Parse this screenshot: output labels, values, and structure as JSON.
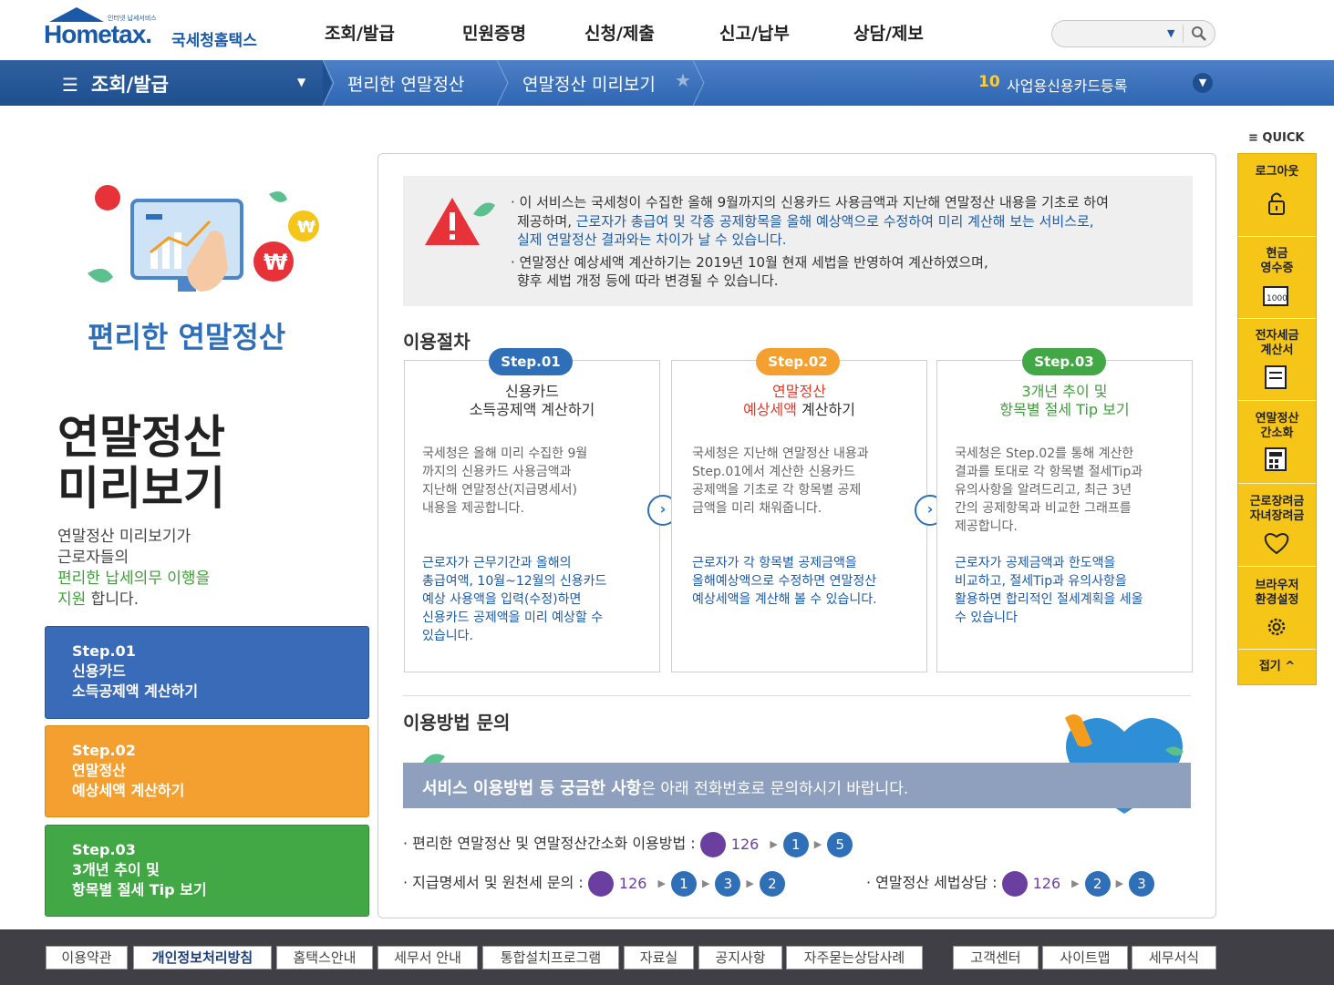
{
  "header": {
    "logo_tiny": "인터넷 납세서비스",
    "logo_brand": "Hometax.",
    "logo_brand_ko": "국세청홈택스",
    "nav": [
      "조회/발급",
      "민원증명",
      "신청/제출",
      "신고/납부",
      "상담/제보"
    ],
    "search": {
      "placeholder": ""
    }
  },
  "bluebar": {
    "menu_title": "조회/발급",
    "crumbs": [
      "편리한 연말정산",
      "연말정산 미리보기"
    ],
    "rank_number": "10",
    "rank_text": "사업용신용카드등록"
  },
  "left": {
    "brand": "편리한 연말정산",
    "title_line1": "연말정산",
    "title_line2": "미리보기",
    "desc_line1": "연말정산 미리보기가",
    "desc_line2": "근로자들의",
    "desc_line3_green": "편리한 납세의무 이행을",
    "desc_line4_green": "지원",
    "desc_line4_rest": " 합니다.",
    "steps": [
      {
        "line1": "Step.01",
        "line2": "신용카드",
        "line3": "소득공제액 계산하기"
      },
      {
        "line1": "Step.02",
        "line2": "연말정산",
        "line3": "예상세액 계산하기"
      },
      {
        "line1": "Step.03",
        "line2": "3개년 추이 및",
        "line3": "항목별 절세 Tip 보기"
      }
    ]
  },
  "notice": {
    "l1": "· 이 서비스는 국세청이 수집한 올해 9월까지의 신용카드 사용금액과 지난해 연말정산 내용을 기초로 하여",
    "l2a": "제공하며, ",
    "l2b": "근로자가 총급여 및 각종 공제항목을 올해 예상액으로 수정하여 미리 계산해 보는 서비스로,",
    "l3": "실제 연말정산 결과와는 차이가 날 수 있습니다.",
    "l4": "· 연말정산 예상세액 계산하기는 2019년 10월 현재 세법을 반영하여 계산하였으며,",
    "l5": "향후 세법 개정 등에 따라 변경될 수 있습니다."
  },
  "procedure": {
    "title": "이용절차",
    "cards": [
      {
        "pill": "Step.01",
        "title1": "신용카드",
        "title2": "소득공제액 계산하기",
        "body": [
          "국세청은 올해 미리 수집한 9월",
          "까지의 신용카드 사용금액과",
          "지난해 연말정산(지급명세서)",
          "내용을 제공합니다."
        ],
        "blue": [
          "근로자가 근무기간과 올해의",
          "총급여액, 10월~12월의 신용카드",
          "예상 사용액을 입력(수정)하면",
          "신용카드 공제액을 미리 예상할 수",
          "있습니다."
        ]
      },
      {
        "pill": "Step.02",
        "title1": "연말정산",
        "title2a": "예상세액",
        "title2b": " 계산하기",
        "body": [
          "국세청은 지난해 연말정산 내용과",
          "Step.01에서 계산한 신용카드",
          "공제액을 기초로 각 항목별 공제",
          "금액을 미리 채워줍니다."
        ],
        "blue": [
          "근로자가 각 항목별 공제금액을",
          "올해예상액으로 수정하면 연말정산",
          "예상세액을 계산해 볼 수 있습니다."
        ]
      },
      {
        "pill": "Step.03",
        "title1": "3개년 추이 및",
        "title2": "항목별 절세 Tip 보기",
        "body": [
          "국세청은 Step.02를 통해 계산한",
          "결과를 토대로 각 항목별 절세Tip과",
          "유의사항을 알려드리고, 최근 3년",
          "간의 공제항목과 비교한 그래프를",
          "제공합니다."
        ],
        "blue": [
          "근로자가 공제금액과 한도액을",
          "비교하고, 절세Tip과 유의사항을",
          "활용하면 합리적인 절세계획을 세울",
          "수 있습니다"
        ]
      }
    ]
  },
  "contact": {
    "title": "이용방법 문의",
    "banner_big": "서비스 이용방법 등 궁금한 사항",
    "banner_rest": "은 아래 전화번호로 문의하시기 바랍니다.",
    "line1_label": "· 편리한 연말정산 및 연말정산간소화 이용방법 :",
    "line1_num": "126",
    "line1_digits": [
      "1",
      "5"
    ],
    "line2_label": "· 지급명세서 및 원천세 문의 :",
    "line2_num": "126",
    "line2_digits": [
      "1",
      "3",
      "2"
    ],
    "line3_label": "· 연말정산 세법상담 :",
    "line3_num": "126",
    "line3_digits": [
      "2",
      "3"
    ]
  },
  "quick": {
    "title": "QUICK",
    "items": [
      "로그아웃",
      "현금",
      "영수증",
      "전자세금",
      "계산서",
      "연말정산",
      "간소화",
      "근로장려금",
      "자녀장려금",
      "브라우저",
      "환경설정"
    ],
    "collapse": "접기"
  },
  "footer": {
    "links": [
      "이용약관",
      "개인정보처리방침",
      "홈택스안내",
      "세무서 안내",
      "통합설치프로그램",
      "자료실",
      "공지사항",
      "자주묻는상담사례",
      "고객센터",
      "사이트맵",
      "세무서식"
    ]
  },
  "colors": {
    "brand_blue": "#1a5aa8",
    "step1": "#3a6bb8",
    "step2": "#f4a031",
    "step3": "#42a745",
    "quick_yellow": "#f5c518",
    "red_text": "#e03a2a",
    "green_text": "#3f9e3a"
  }
}
